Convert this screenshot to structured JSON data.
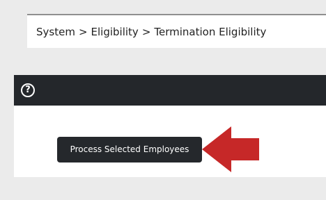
{
  "breadcrumb": {
    "items": [
      "System",
      "Eligibility",
      "Termination Eligibility"
    ],
    "separator": ">"
  },
  "panel": {
    "help_icon": {
      "glyph": "?",
      "name": "help-icon"
    },
    "process_button_label": "Process Selected Employees"
  },
  "annotation": {
    "arrow_icon": "left-arrow-icon",
    "arrow_color": "#c62828"
  },
  "colors": {
    "header_bg": "#24272b",
    "button_bg": "#25282c",
    "page_bg": "#ebebeb"
  }
}
